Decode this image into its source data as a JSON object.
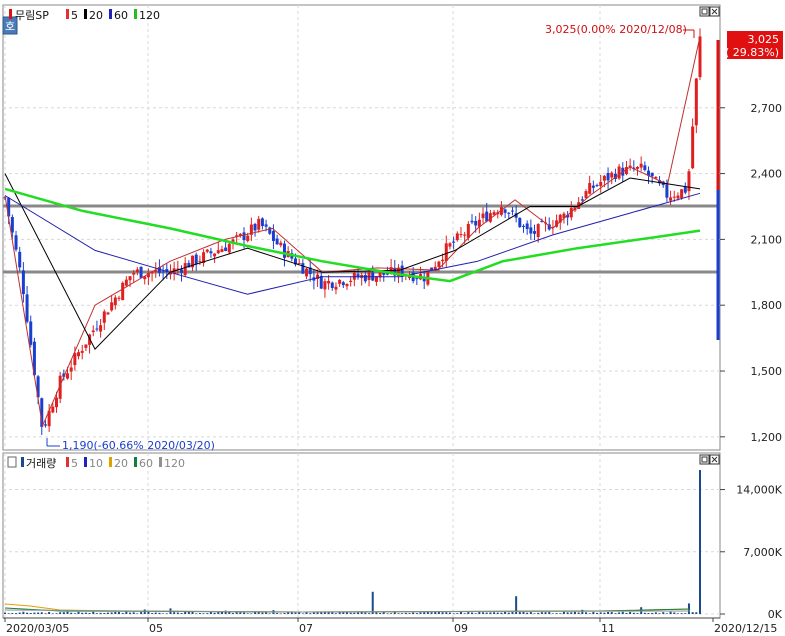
{
  "price_panel": {
    "toggle_label": "호",
    "legend": {
      "name": "무림SP",
      "items": [
        {
          "label": "5",
          "color": "#e03030"
        },
        {
          "label": "20",
          "color": "#000000"
        },
        {
          "label": "60",
          "color": "#2020c0"
        },
        {
          "label": "120",
          "color": "#20c020"
        }
      ]
    },
    "y_ticks": [
      "2,700",
      "2,400",
      "2,100",
      "1,800",
      "1,500",
      "1,200"
    ],
    "high_annotation": "3,025(0.00% 2020/12/08)",
    "low_annotation": "1,190(-60.66% 2020/03/20)",
    "current_price": "3,025",
    "current_change": "( 29.83%)"
  },
  "volume_panel": {
    "legend": {
      "name": "거래량",
      "items": [
        {
          "label": "5",
          "color": "#e03030"
        },
        {
          "label": "10",
          "color": "#2020c0"
        },
        {
          "label": "20",
          "color": "#e0a000"
        },
        {
          "label": "60",
          "color": "#108040"
        },
        {
          "label": "120",
          "color": "#909090"
        }
      ]
    },
    "y_ticks": [
      "14,000K",
      "7,000K",
      "0K"
    ]
  },
  "x_axis": {
    "labels": [
      "2020/03/05",
      "05",
      "07",
      "09",
      "11",
      "2020/12/15"
    ]
  },
  "colors": {
    "up": "#e02020",
    "down": "#1a3fd0",
    "ma5": "#c03030",
    "ma20": "#000000",
    "ma60": "#2020b0",
    "ma120": "#22dd22",
    "support": "#888888",
    "volume": "#1a4a8a"
  },
  "chart_data": [
    {
      "type": "line",
      "series": [
        {
          "name": "5",
          "x": [
            "2020/03/05",
            "2020/03/20",
            "2020/04/10",
            "2020/05/10",
            "2020/06/01",
            "2020/06/20",
            "2020/07/10",
            "2020/08/01",
            "2020/08/25",
            "2020/09/10",
            "2020/09/25",
            "2020/10/10",
            "2020/10/25",
            "2020/11/10",
            "2020/11/25",
            "2020/12/08"
          ],
          "values": [
            2300,
            1250,
            1800,
            2000,
            2100,
            2150,
            1950,
            1970,
            1960,
            2150,
            2280,
            2150,
            2300,
            2430,
            2350,
            3025
          ]
        },
        {
          "name": "20",
          "x": [
            "2020/03/05",
            "2020/04/10",
            "2020/05/10",
            "2020/06/10",
            "2020/07/10",
            "2020/08/10",
            "2020/09/01",
            "2020/10/01",
            "2020/10/20",
            "2020/11/10",
            "2020/12/08"
          ],
          "values": [
            2400,
            1600,
            1950,
            2060,
            1950,
            1960,
            2050,
            2250,
            2250,
            2380,
            2330
          ]
        },
        {
          "name": "60",
          "x": [
            "2020/03/05",
            "2020/04/10",
            "2020/05/10",
            "2020/06/10",
            "2020/07/10",
            "2020/08/10",
            "2020/09/10",
            "2020/10/10",
            "2020/11/10",
            "2020/12/08"
          ],
          "values": [
            2300,
            2050,
            1950,
            1850,
            1930,
            1930,
            2000,
            2120,
            2220,
            2310
          ]
        },
        {
          "name": "120",
          "x": [
            "2020/03/05",
            "2020/04/05",
            "2020/05/10",
            "2020/06/10",
            "2020/07/10",
            "2020/08/10",
            "2020/08/30",
            "2020/09/20",
            "2020/10/20",
            "2020/11/20",
            "2020/12/08"
          ],
          "values": [
            2330,
            2230,
            2150,
            2070,
            2000,
            1940,
            1910,
            2000,
            2060,
            2110,
            2140
          ]
        }
      ],
      "lines": [
        {
          "y": 2250
        },
        {
          "y": 1940
        }
      ],
      "title": "무림SP",
      "ylim": [
        1140,
        3100
      ]
    },
    {
      "type": "bar",
      "title": "거래량",
      "ylim": [
        0,
        16200
      ]
    }
  ]
}
